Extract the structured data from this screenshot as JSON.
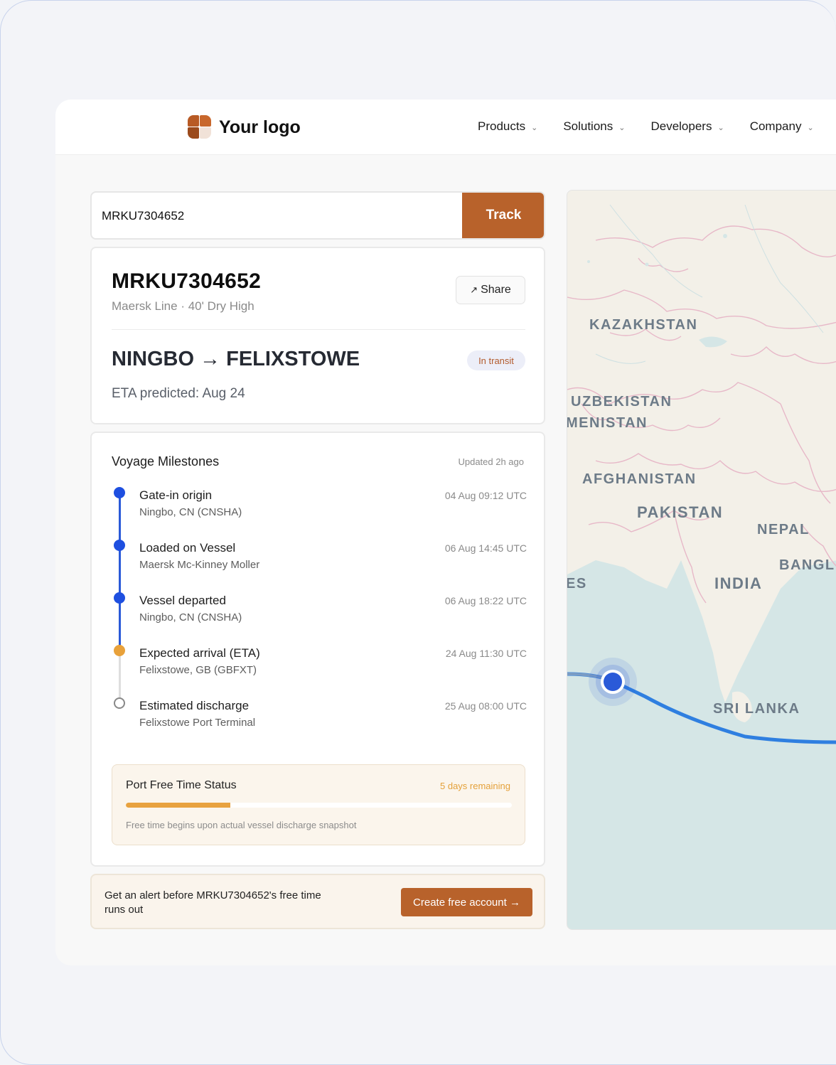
{
  "brand": {
    "name": "Your logo"
  },
  "nav": {
    "items": [
      {
        "label": "Products"
      },
      {
        "label": "Solutions"
      },
      {
        "label": "Developers"
      },
      {
        "label": "Company"
      }
    ]
  },
  "search": {
    "value": "MRKU7304652",
    "button_label": "Track"
  },
  "summary": {
    "container_id": "MRKU7304652",
    "carrier_line": "Maersk Line · 40' Dry High",
    "share_label": "Share",
    "route": "NINGBO → FELIXSTOWE",
    "status_badge": "In transit",
    "eta": "ETA predicted: Aug 24"
  },
  "milestones": {
    "title": "Voyage Milestones",
    "updated": "Updated 2h ago",
    "items": [
      {
        "label": "Gate-in origin",
        "sub": "Ningbo, CN (CNSHA)",
        "time": "04 Aug 09:12 UTC",
        "state": "done"
      },
      {
        "label": "Loaded on Vessel",
        "sub": "Maersk Mc-Kinney Moller",
        "time": "06 Aug 14:45 UTC",
        "state": "done"
      },
      {
        "label": "Vessel departed",
        "sub": "Ningbo, CN (CNSHA)",
        "time": "06 Aug 18:22 UTC",
        "state": "done"
      },
      {
        "label": "Expected arrival (ETA)",
        "sub": "Felixstowe, GB (GBFXT)",
        "time": "24 Aug 11:30 UTC",
        "state": "next"
      },
      {
        "label": "Estimated discharge",
        "sub": "Felixstowe Port Terminal",
        "time": "25 Aug 08:00 UTC",
        "state": "pending"
      }
    ]
  },
  "free_time": {
    "title": "Port Free Time Status",
    "remaining": "5 days remaining",
    "progress": 0.27,
    "note": "Free time begins upon actual vessel discharge snapshot"
  },
  "alert": {
    "text": "Get an alert before MRKU7304652's free time runs out",
    "button_label": "Create free account →"
  },
  "map": {
    "labels": [
      "KAZAKHSTAN",
      "UZBEKISTAN",
      "MENISTAN",
      "AFGHANISTAN",
      "PAKISTAN",
      "NEPAL",
      "BANGL",
      "INDIA",
      "ES",
      "SRI LANKA"
    ]
  },
  "colors": {
    "accent": "#b8622b",
    "route_blue": "#2f7fe0",
    "vessel_marker": "#2a5ad8",
    "milestone_done": "#1e4fe0",
    "milestone_next": "#e8a13a"
  }
}
